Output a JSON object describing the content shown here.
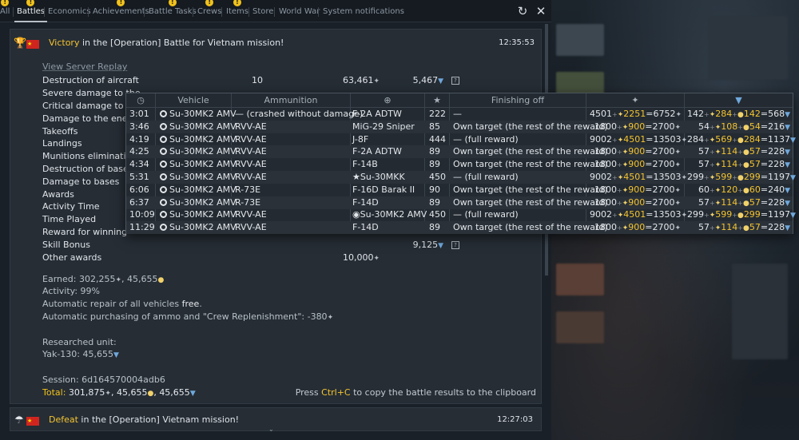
{
  "tabs": [
    {
      "label": "All",
      "badge": true
    },
    {
      "label": "Battles",
      "badge": true,
      "active": true
    },
    {
      "label": "Economics",
      "badge": false
    },
    {
      "label": "Achievements",
      "badge": true
    },
    {
      "label": "Battle Tasks",
      "badge": true
    },
    {
      "label": "Crews",
      "badge": true
    },
    {
      "label": "Items",
      "badge": true
    },
    {
      "label": "Store",
      "badge": false
    },
    {
      "label": "World War",
      "badge": false
    },
    {
      "label": "System notifications",
      "badge": false
    }
  ],
  "window": {
    "refresh_icon": "refresh-icon",
    "close_icon": "close-icon"
  },
  "entry1": {
    "result": "Victory",
    "text_rest": " in the [Operation] Battle for Vietnam mission!",
    "time": "12:35:53",
    "replay_link": "View Server Replay",
    "rewards": [
      {
        "label": "Destruction of aircraft",
        "count": "10",
        "sl": "63,461",
        "rp": "5,467"
      },
      {
        "label": "Severe damage to the",
        "count": "",
        "sl": "",
        "rp": ""
      },
      {
        "label": "Critical damage to the",
        "count": "",
        "sl": "",
        "rp": ""
      },
      {
        "label": "Damage to the enemy",
        "count": "",
        "sl": "",
        "rp": ""
      },
      {
        "label": "Takeoffs",
        "count": "",
        "sl": "",
        "rp": ""
      },
      {
        "label": "Landings",
        "count": "",
        "sl": "",
        "rp": ""
      },
      {
        "label": "Munitions elimination",
        "count": "",
        "sl": "",
        "rp": ""
      },
      {
        "label": "Destruction of bases",
        "count": "",
        "sl": "",
        "rp": ""
      },
      {
        "label": "Damage to bases",
        "count": "",
        "sl": "",
        "rp": ""
      },
      {
        "label": "Awards",
        "count": "",
        "sl": "",
        "rp": ""
      },
      {
        "label": "Activity Time",
        "count": "",
        "sl": "",
        "rp": ""
      },
      {
        "label": "Time Played",
        "count": "",
        "sl": "",
        "rp": ""
      },
      {
        "label": "Reward for winning",
        "count": "",
        "sl": "",
        "rp": ""
      },
      {
        "label": "Skill Bonus",
        "count": "",
        "sl": "",
        "rp": "9,125"
      },
      {
        "label": "Other awards",
        "count": "",
        "sl": "10,000",
        "rp": ""
      }
    ],
    "earned_label": "Earned: ",
    "earned_sl": "302,255",
    "earned_rp": "45,655",
    "activity": "Activity: 99%",
    "repair_prefix": "Automatic repair of all vehicles ",
    "repair_value": "free",
    "repair_suffix": ".",
    "ammo_text": "Automatic purchasing of ammo and \"Crew Replenishment\": -380",
    "researched_label": "Researched unit:",
    "researched_unit": "Yak-130: 45,655",
    "session": "Session: 6d164570004adb6",
    "total_label": "Total:",
    "total_sl": "301,875",
    "total_rp1": "45,655",
    "total_rp2": "45,655",
    "copy_prefix": "Press ",
    "copy_key": "Ctrl+C",
    "copy_suffix": " to copy the battle results to the clipboard"
  },
  "tooltip": {
    "headers": {
      "time": "clock-icon",
      "vehicle": "Vehicle",
      "ammo": "Ammunition",
      "target": "target-icon",
      "score": "★",
      "finish": "Finishing off",
      "sl": "silver-lions-icon",
      "rp": "research-points-icon"
    },
    "rows": [
      {
        "time": "3:01",
        "vehicle": "Su-30MK2 AMV",
        "ammo": "— (crashed without damage)",
        "target": "F-2A ADTW",
        "target_icon": "",
        "score": "222",
        "finish": "—",
        "sl_base": "4501",
        "sl_bonus": "2251",
        "sl_total": "6752",
        "rp_base": "142",
        "rp_b1": "284",
        "rp_b2": "142",
        "rp_total": "568"
      },
      {
        "time": "3:46",
        "vehicle": "Su-30MK2 AMV",
        "ammo": "RVV-AE",
        "target": "MiG-29 Sniper",
        "target_icon": "",
        "score": "85",
        "finish": "Own target (the rest of the reward)",
        "sl_base": "1800",
        "sl_bonus": "900",
        "sl_total": "2700",
        "rp_base": "54",
        "rp_b1": "108",
        "rp_b2": "54",
        "rp_total": "216"
      },
      {
        "time": "4:19",
        "vehicle": "Su-30MK2 AMV",
        "ammo": "RVV-AE",
        "target": "J-8F",
        "target_icon": "",
        "score": "444",
        "finish": "— (full reward)",
        "sl_base": "9002",
        "sl_bonus": "4501",
        "sl_total": "13503",
        "rp_base": "284",
        "rp_b1": "569",
        "rp_b2": "284",
        "rp_total": "1137"
      },
      {
        "time": "4:25",
        "vehicle": "Su-30MK2 AMV",
        "ammo": "RVV-AE",
        "target": "F-2A ADTW",
        "target_icon": "",
        "score": "89",
        "finish": "Own target (the rest of the reward)",
        "sl_base": "1800",
        "sl_bonus": "900",
        "sl_total": "2700",
        "rp_base": "57",
        "rp_b1": "114",
        "rp_b2": "57",
        "rp_total": "228"
      },
      {
        "time": "4:34",
        "vehicle": "Su-30MK2 AMV",
        "ammo": "RVV-AE",
        "target": "F-14B",
        "target_icon": "",
        "score": "89",
        "finish": "Own target (the rest of the reward)",
        "sl_base": "1800",
        "sl_bonus": "900",
        "sl_total": "2700",
        "rp_base": "57",
        "rp_b1": "114",
        "rp_b2": "57",
        "rp_total": "228"
      },
      {
        "time": "5:31",
        "vehicle": "Su-30MK2 AMV",
        "ammo": "RVV-AE",
        "target": "Su-30MKK",
        "target_icon": "★",
        "score": "450",
        "finish": "— (full reward)",
        "sl_base": "9002",
        "sl_bonus": "4501",
        "sl_total": "13503",
        "rp_base": "299",
        "rp_b1": "599",
        "rp_b2": "299",
        "rp_total": "1197"
      },
      {
        "time": "6:06",
        "vehicle": "Su-30MK2 AMV",
        "ammo": "R-73E",
        "target": "F-16D Barak II",
        "target_icon": "",
        "score": "90",
        "finish": "Own target (the rest of the reward)",
        "sl_base": "1800",
        "sl_bonus": "900",
        "sl_total": "2700",
        "rp_base": "60",
        "rp_b1": "120",
        "rp_b2": "60",
        "rp_total": "240"
      },
      {
        "time": "6:37",
        "vehicle": "Su-30MK2 AMV",
        "ammo": "R-73E",
        "target": "F-14D",
        "target_icon": "",
        "score": "89",
        "finish": "Own target (the rest of the reward)",
        "sl_base": "1800",
        "sl_bonus": "900",
        "sl_total": "2700",
        "rp_base": "57",
        "rp_b1": "114",
        "rp_b2": "57",
        "rp_total": "228"
      },
      {
        "time": "10:09",
        "vehicle": "Su-30MK2 AMV",
        "ammo": "RVV-AE",
        "target": "Su-30MK2 AMV",
        "target_icon": "◉",
        "score": "450",
        "finish": "— (full reward)",
        "sl_base": "9002",
        "sl_bonus": "4501",
        "sl_total": "13503",
        "rp_base": "299",
        "rp_b1": "599",
        "rp_b2": "299",
        "rp_total": "1197"
      },
      {
        "time": "11:29",
        "vehicle": "Su-30MK2 AMV",
        "ammo": "RVV-AE",
        "target": "F-14D",
        "target_icon": "",
        "score": "89",
        "finish": "Own target (the rest of the reward)",
        "sl_base": "1800",
        "sl_bonus": "900",
        "sl_total": "2700",
        "rp_base": "57",
        "rp_b1": "114",
        "rp_b2": "57",
        "rp_total": "228"
      }
    ]
  },
  "entry2": {
    "result": "Defeat",
    "text_rest": " in the [Operation] Vietnam mission!",
    "time": "12:27:03"
  },
  "colors": {
    "accent_yellow": "#f4c430",
    "rp_blue": "#6fa8dc",
    "panel": "#262d35",
    "tooltip_bg": "#232a31"
  }
}
